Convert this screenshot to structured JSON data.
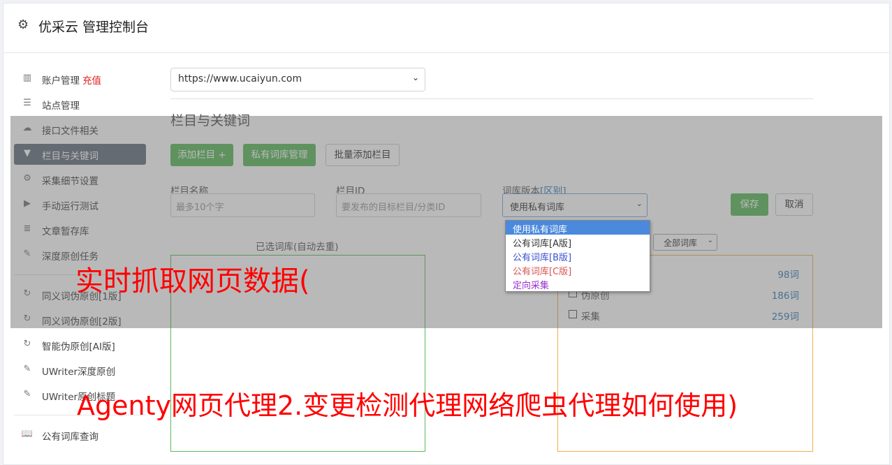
{
  "header": {
    "title": "优采云 管理控制台"
  },
  "sidebar": {
    "items": [
      {
        "label": "账户管理",
        "extra": "充值"
      },
      {
        "label": "站点管理"
      },
      {
        "label": "接口文件相关"
      },
      {
        "label": "栏目与关键词"
      },
      {
        "label": "采集细节设置"
      },
      {
        "label": "手动运行测试"
      },
      {
        "label": "文章暂存库"
      },
      {
        "label": "深度原创任务"
      },
      {
        "label": "同义词伪原创[1版]"
      },
      {
        "label": "同义词伪原创[2版]"
      },
      {
        "label": "智能伪原创[AI版]"
      },
      {
        "label": "UWriter深度原创"
      },
      {
        "label": "UWriter原创标题"
      },
      {
        "label": "公有词库查询"
      }
    ]
  },
  "site_select": {
    "value": "https://www.ucaiyun.com"
  },
  "section_title": "栏目与关键词",
  "buttons": {
    "add_column": "添加栏目 +",
    "private_lib": "私有词库管理",
    "batch_add": "批量添加栏目",
    "save": "保存",
    "cancel": "取消"
  },
  "form": {
    "name_label": "栏目名称",
    "name_placeholder": "最多10个字",
    "id_label": "栏目ID",
    "id_placeholder": "要发布的目标栏目/分类ID",
    "version_label": "词库版本",
    "version_link": "[区别]",
    "version_value": "使用私有词库"
  },
  "dropdown_options": [
    "使用私有词库",
    "公有词库[A版]",
    "公有词库[B版]",
    "公有词库[C版]",
    "定向采集"
  ],
  "dropdown_colors": [
    "#ffffff",
    "#333333",
    "#3a4fd0",
    "#d9534f",
    "#9b30d0"
  ],
  "selected_panel": {
    "title": "已选词库(自动去重)"
  },
  "library_filter": {
    "value": "全部词库"
  },
  "libraries": [
    {
      "name": "",
      "count": "98词"
    },
    {
      "name": "伪原创",
      "count": "186词"
    },
    {
      "name": "采集",
      "count": "259词"
    }
  ],
  "watermark": {
    "line1": "实时抓取网页数据(",
    "line2": "Agenty网页代理2.变更检测代理网络爬虫代理如何使用)"
  }
}
